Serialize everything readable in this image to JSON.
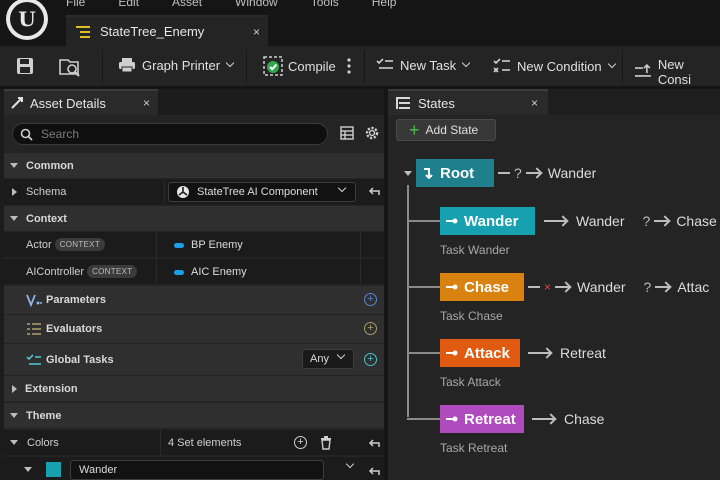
{
  "menu": [
    "File",
    "Edit",
    "Asset",
    "Window",
    "Tools",
    "Help"
  ],
  "document_tab": {
    "title": "StateTree_Enemy",
    "close": "×"
  },
  "toolbar": {
    "graph_printer": "Graph Printer",
    "compile": "Compile",
    "new_task": "New Task",
    "new_condition": "New Condition",
    "new_consideration": "New Consi"
  },
  "asset_details": {
    "tab_label": "Asset Details",
    "close": "×",
    "search_placeholder": "Search",
    "common": "Common",
    "schema_label": "Schema",
    "schema_value": "StateTree AI Component",
    "context": "Context",
    "actor_label": "Actor",
    "actor_badge": "CONTEXT",
    "actor_value": "BP Enemy",
    "aicontroller_label": "AIController",
    "aicontroller_badge": "CONTEXT",
    "aicontroller_value": "AIC Enemy",
    "parameters": "Parameters",
    "evaluators": "Evaluators",
    "global_tasks": "Global Tasks",
    "global_tasks_mode": "Any",
    "extension": "Extension",
    "theme": "Theme",
    "colors_label": "Colors",
    "colors_value": "4 Set elements",
    "color_entry": "Wander",
    "color_entry_hex": "#17a0b0"
  },
  "states_panel": {
    "tab_label": "States",
    "close": "×",
    "add_state": "Add State",
    "states": [
      {
        "name": "Root",
        "color": "#1f7f8c",
        "task": "",
        "transitions": [
          "? →",
          "Wander"
        ]
      },
      {
        "name": "Wander",
        "color": "#17a0b0",
        "task": "Task Wander",
        "transitions": [
          "Wander",
          "Chase"
        ]
      },
      {
        "name": "Chase",
        "color": "#d9820f",
        "task": "Task Chase",
        "transitions": [
          "Wander",
          "Attack"
        ]
      },
      {
        "name": "Attack",
        "color": "#e05a10",
        "task": "Task Attack",
        "transitions": [
          "Retreat"
        ]
      },
      {
        "name": "Retreat",
        "color": "#b04bbd",
        "task": "Task Retreat",
        "transitions": [
          "Chase"
        ]
      }
    ],
    "root_transition": "Wander",
    "wander_t1": "Wander",
    "wander_t2": "Chase",
    "chase_t1": "Wander",
    "chase_t2": "Attac",
    "attack_t1": "Retreat",
    "retreat_t1": "Chase"
  }
}
